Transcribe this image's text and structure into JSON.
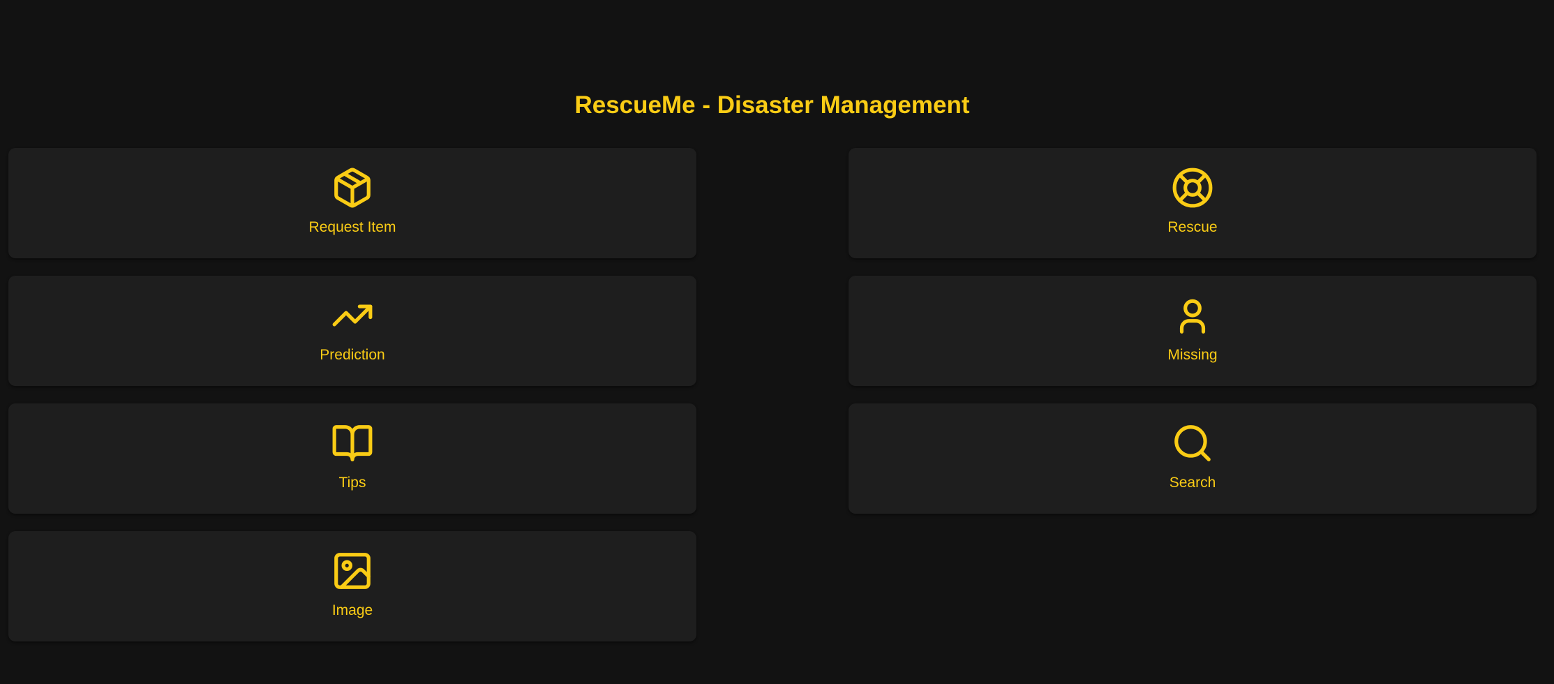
{
  "header": {
    "title": "RescueMe - Disaster Management"
  },
  "colors": {
    "background": "#121212",
    "card": "#1e1e1e",
    "accent": "#facc15"
  },
  "cards": [
    {
      "label": "Request Item",
      "icon": "package-icon"
    },
    {
      "label": "Rescue",
      "icon": "life-buoy-icon"
    },
    {
      "label": "Prediction",
      "icon": "trending-up-icon"
    },
    {
      "label": "Missing",
      "icon": "user-icon"
    },
    {
      "label": "Tips",
      "icon": "book-open-icon"
    },
    {
      "label": "Search",
      "icon": "search-icon"
    },
    {
      "label": "Image",
      "icon": "image-icon"
    }
  ]
}
